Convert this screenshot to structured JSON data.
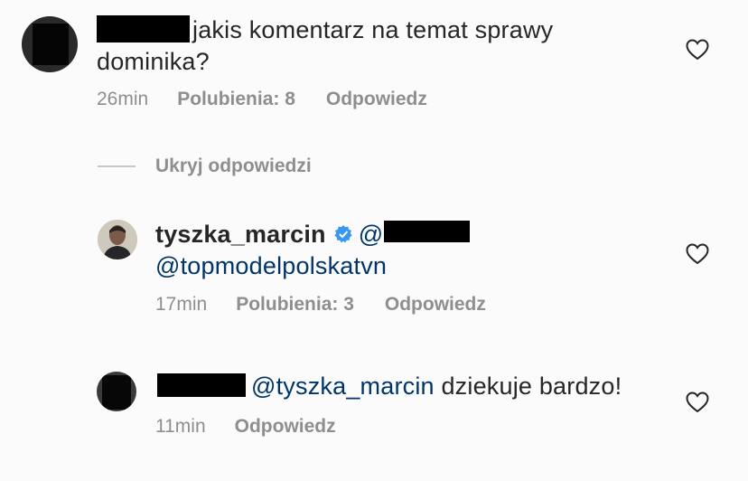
{
  "comments": [
    {
      "text_line1": "jakis komentarz na temat sprawy",
      "text_line2": "dominika?",
      "time": "26min",
      "likes": "Polubienia: 8",
      "reply": "Odpowiedz"
    },
    {
      "username": "tyszka_marcin",
      "mention_prefix": "@",
      "mention_line2": "@topmodelpolskatvn",
      "time": "17min",
      "likes": "Polubienia: 3",
      "reply": "Odpowiedz"
    },
    {
      "mention": "@tyszka_marcin",
      "text": "dziekuje bardzo!",
      "time": "11min",
      "reply": "Odpowiedz"
    }
  ],
  "hide_replies": "Ukryj odpowiedzi",
  "icons": {
    "like": "heart-outline-icon",
    "verified": "verified-badge-icon"
  },
  "colors": {
    "text": "#262626",
    "meta": "#8e8e8e",
    "mention": "#003569",
    "verified": "#3897f0"
  }
}
